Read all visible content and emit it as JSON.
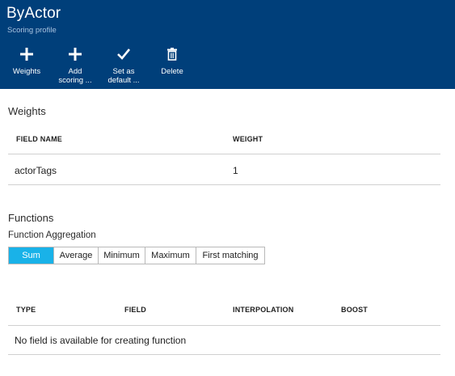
{
  "header": {
    "title": "ByActor",
    "subtitle": "Scoring profile"
  },
  "toolbar": {
    "weights": {
      "label": "Weights",
      "icon": "plus-icon"
    },
    "add_scoring": {
      "label_line1": "Add",
      "label_line2": "scoring ...",
      "icon": "plus-icon"
    },
    "set_default": {
      "label_line1": "Set as",
      "label_line2": "default ...",
      "icon": "checkmark-icon"
    },
    "delete": {
      "label": "Delete",
      "icon": "trash-icon"
    }
  },
  "weights": {
    "title": "Weights",
    "columns": {
      "field_name": "FIELD NAME",
      "weight": "WEIGHT"
    },
    "rows": [
      {
        "field_name": "actorTags",
        "weight": "1"
      }
    ]
  },
  "functions": {
    "title": "Functions",
    "aggregation_label": "Function Aggregation",
    "aggregation_options": [
      "Sum",
      "Average",
      "Minimum",
      "Maximum",
      "First matching"
    ],
    "aggregation_selected": "Sum",
    "columns": {
      "type": "TYPE",
      "field": "FIELD",
      "interpolation": "INTERPOLATION",
      "boost": "BOOST"
    },
    "empty_message": "No field is available for creating function"
  },
  "colors": {
    "header_bg": "#003f7a",
    "accent": "#19b2e8"
  }
}
